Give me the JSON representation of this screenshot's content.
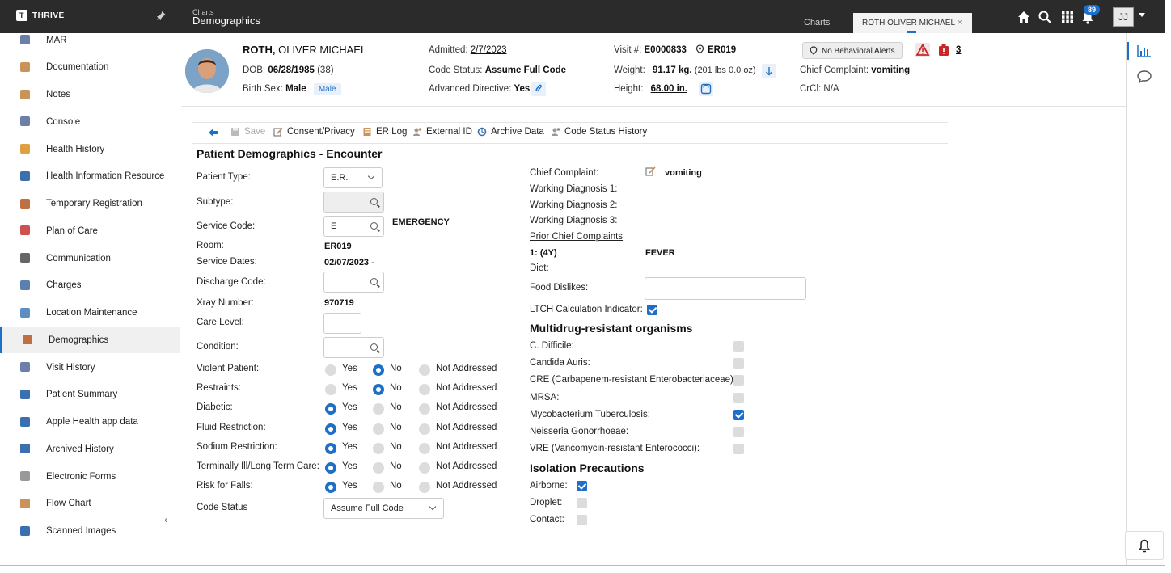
{
  "app": {
    "brand": "THRIVE",
    "breadcrumb_parent": "Charts",
    "breadcrumb_title": "Demographics",
    "tab_charts": "Charts",
    "tab_patient": "ROTH OLIVER MICHAEL",
    "tab_close": "×",
    "notification_count": "89",
    "user_initials": "JJ"
  },
  "sidebar": {
    "items": [
      {
        "label": "MAR",
        "icon": "mar-icon",
        "color": "#6b7fa8"
      },
      {
        "label": "Documentation",
        "icon": "documentation-icon",
        "color": "#c9935a"
      },
      {
        "label": "Notes",
        "icon": "notes-icon",
        "color": "#c9935a"
      },
      {
        "label": "Console",
        "icon": "console-icon",
        "color": "#6b7fa8"
      },
      {
        "label": "Health History",
        "icon": "health-history-icon",
        "color": "#e0a040"
      },
      {
        "label": "Health Information Resource",
        "icon": "globe-icon",
        "color": "#3a6fb0"
      },
      {
        "label": "Temporary Registration",
        "icon": "person-icon",
        "color": "#c07040"
      },
      {
        "label": "Plan of Care",
        "icon": "plan-of-care-icon",
        "color": "#d05050"
      },
      {
        "label": "Communication",
        "icon": "phone-icon",
        "color": "#666666"
      },
      {
        "label": "Charges",
        "icon": "charges-icon",
        "color": "#5a7fb0"
      },
      {
        "label": "Location Maintenance",
        "icon": "location-icon",
        "color": "#5a8fc0"
      },
      {
        "label": "Demographics",
        "icon": "demographics-icon",
        "color": "#c07040"
      },
      {
        "label": "Visit History",
        "icon": "visit-history-icon",
        "color": "#6b7fa8"
      },
      {
        "label": "Patient Summary",
        "icon": "patient-summary-icon",
        "color": "#3a6fb0"
      },
      {
        "label": "Apple Health app data",
        "icon": "bar-chart-icon",
        "color": "#3a6fb0"
      },
      {
        "label": "Archived History",
        "icon": "archive-icon",
        "color": "#3a6fb0"
      },
      {
        "label": "Electronic Forms",
        "icon": "forms-icon",
        "color": "#999999"
      },
      {
        "label": "Flow Chart",
        "icon": "flow-chart-icon",
        "color": "#c9935a"
      },
      {
        "label": "Scanned Images",
        "icon": "scanned-images-icon",
        "color": "#3a6fb0"
      }
    ],
    "active": "Demographics",
    "collapse_glyph": "‹"
  },
  "header": {
    "last_name": "ROTH",
    "first_names": "OLIVER MICHAEL",
    "dob_label": "DOB:",
    "dob": "06/28/1985",
    "age": "(38)",
    "birth_sex_label": "Birth Sex:",
    "birth_sex": "Male",
    "birth_sex_pill": "Male",
    "admitted_label": "Admitted:",
    "admitted": "2/7/2023",
    "code_status_label": "Code Status:",
    "code_status": "Assume Full Code",
    "adv_directive_label": "Advanced Directive:",
    "adv_directive": "Yes",
    "visit_label": "Visit #:",
    "visit": "E0000833",
    "location": "ER019",
    "weight_label": "Weight:",
    "weight": "91.17 kg.",
    "weight_lbs": "(201 lbs 0.0 oz)",
    "height_label": "Height:",
    "height": "68.00 in.",
    "behavioral": "No Behavioral Alerts",
    "alert_count": "3",
    "chief_complaint_label": "Chief Complaint:",
    "chief_complaint": "vomiting",
    "crcl_label": "CrCl:",
    "crcl": "N/A"
  },
  "toolbar": {
    "save": "Save",
    "consent": "Consent/Privacy",
    "er_log": "ER Log",
    "external_id": "External ID",
    "archive": "Archive Data",
    "code_status_history": "Code Status History"
  },
  "form": {
    "title": "Patient Demographics - Encounter",
    "patient_type_label": "Patient Type:",
    "patient_type": "E.R.",
    "subtype_label": "Subtype:",
    "service_code_label": "Service Code:",
    "service_code": "E",
    "service_code_desc": "EMERGENCY",
    "room_label": "Room:",
    "room": "ER019",
    "service_dates_label": "Service Dates:",
    "service_dates": "02/07/2023 -",
    "discharge_code_label": "Discharge Code:",
    "xray_label": "Xray Number:",
    "xray": "970719",
    "care_level_label": "Care Level:",
    "condition_label": "Condition:",
    "radio_yes": "Yes",
    "radio_no": "No",
    "radio_na": "Not Addressed",
    "radio_rows": [
      {
        "label": "Violent Patient:",
        "value": "No"
      },
      {
        "label": "Restraints:",
        "value": "No"
      },
      {
        "label": "Diabetic:",
        "value": "Yes"
      },
      {
        "label": "Fluid Restriction:",
        "value": "Yes"
      },
      {
        "label": "Sodium Restriction:",
        "value": "Yes"
      },
      {
        "label": "Terminally Ill/Long Term Care:",
        "value": "Yes"
      },
      {
        "label": "Risk for Falls:",
        "value": "Yes"
      }
    ],
    "code_status_label": "Code Status",
    "code_status": "Assume Full Code"
  },
  "right": {
    "chief_complaint_label": "Chief Complaint:",
    "chief_complaint": "vomiting",
    "wd1": "Working Diagnosis 1:",
    "wd2": "Working Diagnosis 2:",
    "wd3": "Working Diagnosis 3:",
    "prior_link": "Prior Chief Complaints",
    "prior_item_label": "1: (4Y)",
    "prior_item_value": "FEVER",
    "diet_label": "Diet:",
    "food_dislikes_label": "Food Dislikes:",
    "ltch_label": "LTCH Calculation Indicator:",
    "ltch_checked": true,
    "mdro_title": "Multidrug-resistant organisms",
    "mdro": [
      {
        "label": "C. Difficile:",
        "checked": false
      },
      {
        "label": "Candida Auris:",
        "checked": false
      },
      {
        "label": "CRE (Carbapenem-resistant Enterobacteriaceae):",
        "checked": false
      },
      {
        "label": "MRSA:",
        "checked": false
      },
      {
        "label": "Mycobacterium Tuberculosis:",
        "checked": true
      },
      {
        "label": "Neisseria Gonorrhoeae:",
        "checked": false
      },
      {
        "label": "VRE (Vancomycin-resistant Enterococci):",
        "checked": false
      }
    ],
    "iso_title": "Isolation Precautions",
    "iso": [
      {
        "label": "Airborne:",
        "checked": true
      },
      {
        "label": "Droplet:",
        "checked": false
      },
      {
        "label": "Contact:",
        "checked": false
      }
    ]
  },
  "colors": {
    "accent": "#1e6fc8",
    "topbar": "#2b2b2b",
    "alert_red": "#c62828"
  }
}
